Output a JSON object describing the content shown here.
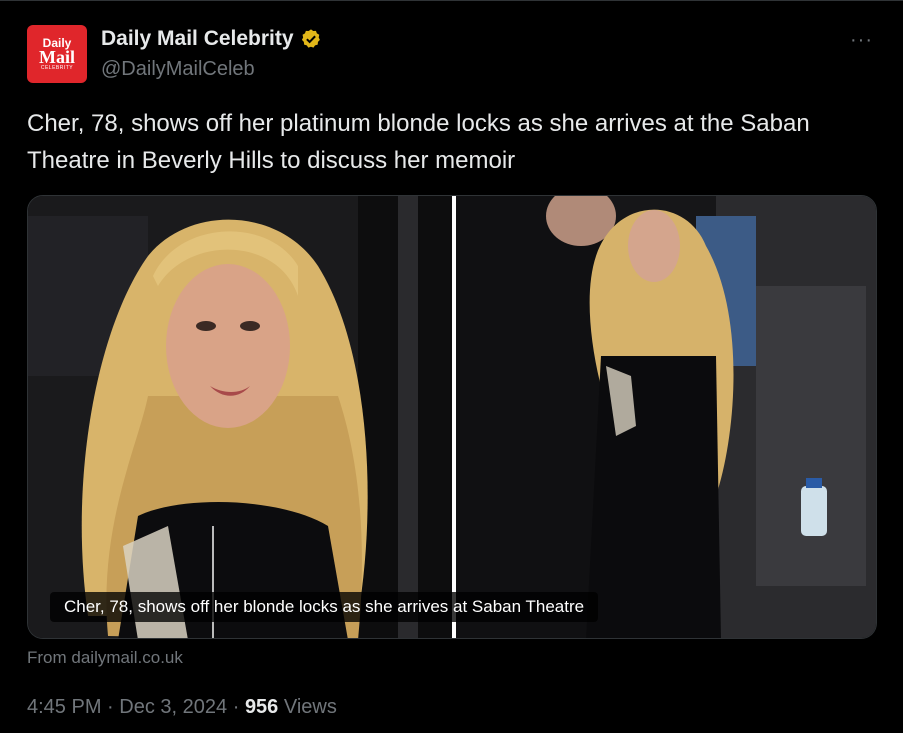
{
  "account": {
    "display_name": "Daily Mail Celebrity",
    "handle": "@DailyMailCeleb",
    "avatar_line1": "Daily",
    "avatar_line2": "Mail",
    "avatar_line3": "CELEBRITY",
    "verified_icon": "verified-badge-icon",
    "verified_color": "#e2b719"
  },
  "more_label": "···",
  "tweet_text": "Cher, 78, shows off her platinum blonde locks as she arrives at the Saban Theatre in Beverly Hills to discuss her memoir",
  "card": {
    "caption": "Cher, 78, shows off her blonde locks as she arrives at Saban Theatre",
    "source": "From dailymail.co.uk"
  },
  "meta": {
    "time": "4:45 PM",
    "separator": "·",
    "date": "Dec 3, 2024",
    "views_count": "956",
    "views_label": "Views"
  },
  "colors": {
    "background": "#000000",
    "text_primary": "#e7e9ea",
    "text_secondary": "#71767b",
    "brand_red": "#e0262b"
  }
}
